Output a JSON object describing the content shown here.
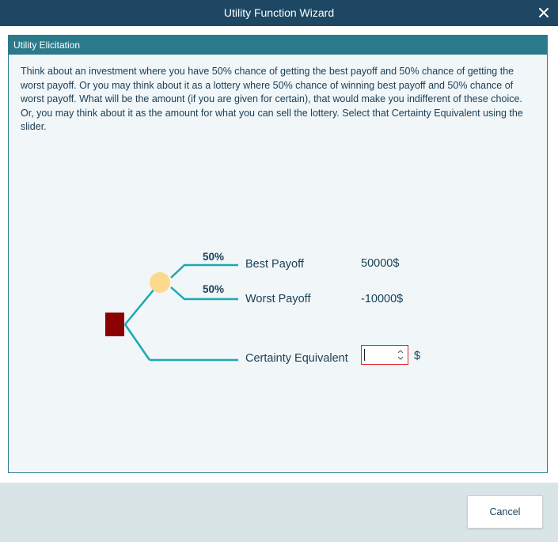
{
  "window": {
    "title": "Utility Function Wizard",
    "close_icon": "close-icon"
  },
  "panel": {
    "header": "Utility Elicitation",
    "instructions": "Think about an investment where you have 50% chance of getting the best payoff and 50% chance of getting the worst payoff. Or you may think about it as a lottery where 50% chance of winning best payoff and 50% chance of worst payoff. What will be the amount (if you are given for certain), that would make you indifferent of these choice. Or, you may think about it as the amount for what you can sell the lottery. Select that Certainty Equivalent using the slider."
  },
  "tree": {
    "best": {
      "probability": "50%",
      "label": "Best Payoff",
      "value": "50000$"
    },
    "worst": {
      "probability": "50%",
      "label": "Worst Payoff",
      "value": "-10000$"
    },
    "certainty": {
      "label": "Certainty Equivalent",
      "value": "",
      "unit": "$"
    },
    "colors": {
      "decision_node": "#8b0000",
      "chance_node": "#fdd98c",
      "branch": "#1aa8b4",
      "input_border": "#e0262b"
    }
  },
  "footer": {
    "cancel_label": "Cancel"
  }
}
